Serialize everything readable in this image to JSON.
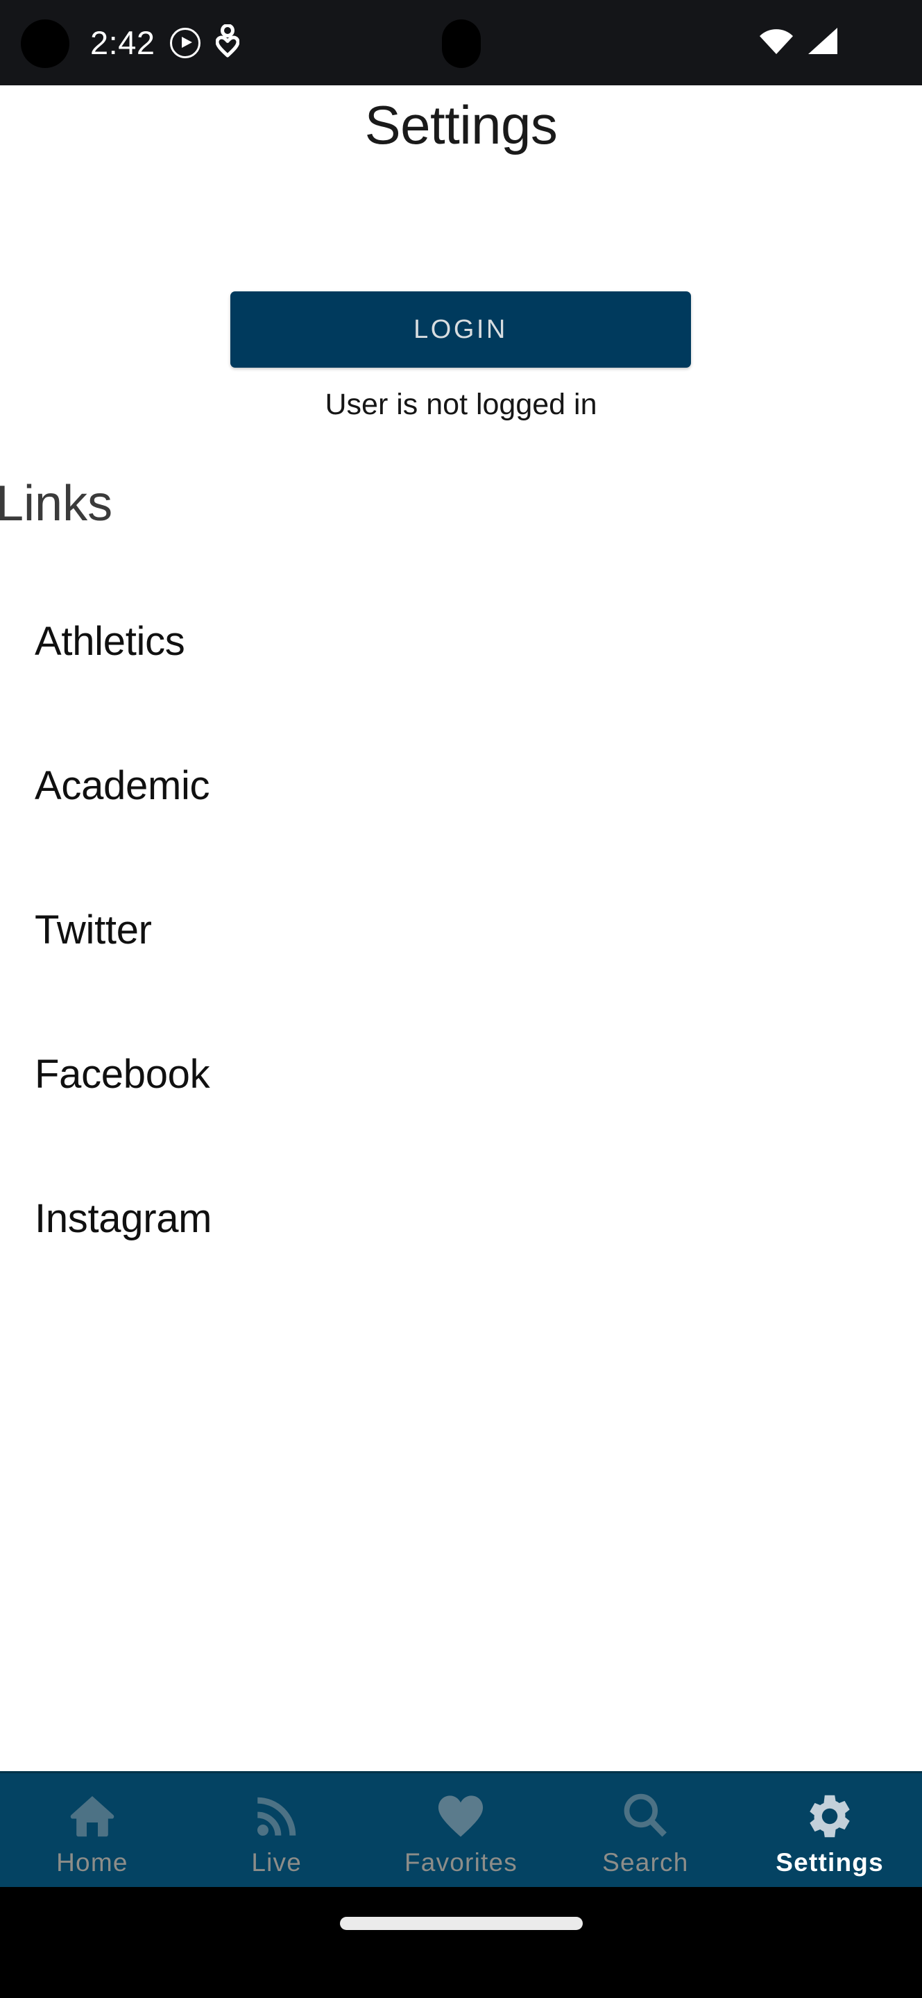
{
  "status_bar": {
    "time": "2:42",
    "icons_left": [
      "camera-cutout",
      "play-circle-icon",
      "person-heart-icon"
    ],
    "icons_right": [
      "wifi-icon",
      "cellular-signal-icon"
    ],
    "background_color": "#141518",
    "foreground_color": "#ffffff"
  },
  "header": {
    "title": "Settings"
  },
  "login": {
    "button_label": "LOGIN",
    "status_text": "User is not logged in",
    "button_color": "#003a5d",
    "button_text_color": "#d8dde0"
  },
  "links": {
    "section_header": "Links",
    "items": [
      {
        "label": "Athletics"
      },
      {
        "label": "Academic"
      },
      {
        "label": "Twitter"
      },
      {
        "label": "Facebook"
      },
      {
        "label": "Instagram"
      }
    ]
  },
  "bottom_nav": {
    "background_color": "#044363",
    "inactive_label_color": "#8d8d89",
    "inactive_icon_color": "#4d7285",
    "active_label_color": "#ffffff",
    "active_icon_color": "#c3d0da",
    "active_index": 4,
    "items": [
      {
        "label": "Home",
        "icon": "home-icon"
      },
      {
        "label": "Live",
        "icon": "broadcast-icon"
      },
      {
        "label": "Favorites",
        "icon": "heart-icon"
      },
      {
        "label": "Search",
        "icon": "magnifier-icon"
      },
      {
        "label": "Settings",
        "icon": "gear-icon"
      }
    ]
  },
  "gesture_bar": {
    "handle": "home-gesture-pill",
    "background_color": "#000000"
  }
}
